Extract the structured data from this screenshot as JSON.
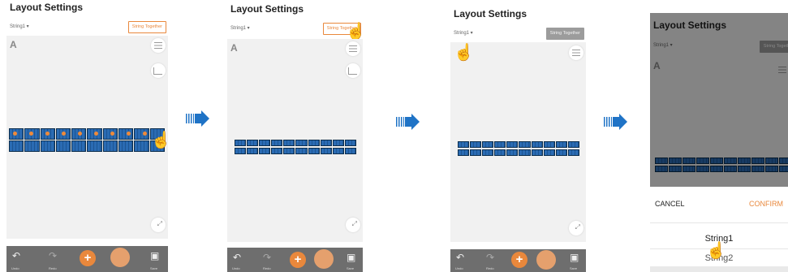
{
  "panels": [
    {
      "title": "Layout Settings",
      "string_label": "String1 ▾",
      "button": "String Together"
    },
    {
      "title": "Layout Settings",
      "string_label": "String1 ▾",
      "button": "String Together"
    },
    {
      "title": "Layout Settings",
      "string_label": "String1 ▾",
      "button": "String Together"
    },
    {
      "title": "Layout Settings",
      "string_label": "String1 ▾",
      "button": "String Together"
    }
  ],
  "toolbar": {
    "undo": "Undo",
    "redo": "Redo",
    "save": "Save"
  },
  "sheet": {
    "cancel": "CANCEL",
    "confirm": "CONFIRM",
    "options": [
      "String1",
      "String2"
    ]
  },
  "colors": {
    "accent": "#e9883c",
    "arrow": "#1f73c6",
    "module": "#2a6bb3"
  }
}
